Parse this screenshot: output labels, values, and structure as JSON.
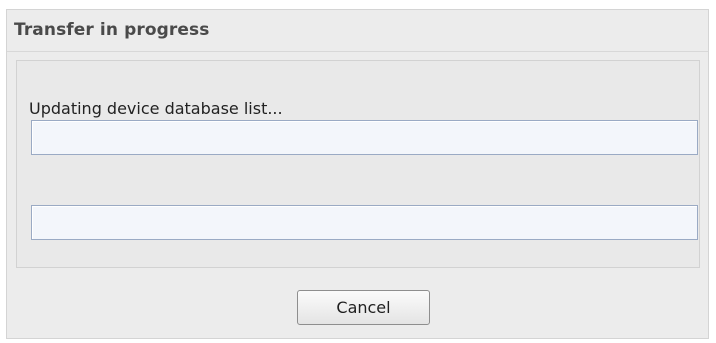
{
  "dialog": {
    "title": "Transfer in progress",
    "status_text": "Updating device database list...",
    "progress": [
      {
        "value": 0
      },
      {
        "value": 0
      }
    ],
    "cancel_label": "Cancel"
  }
}
